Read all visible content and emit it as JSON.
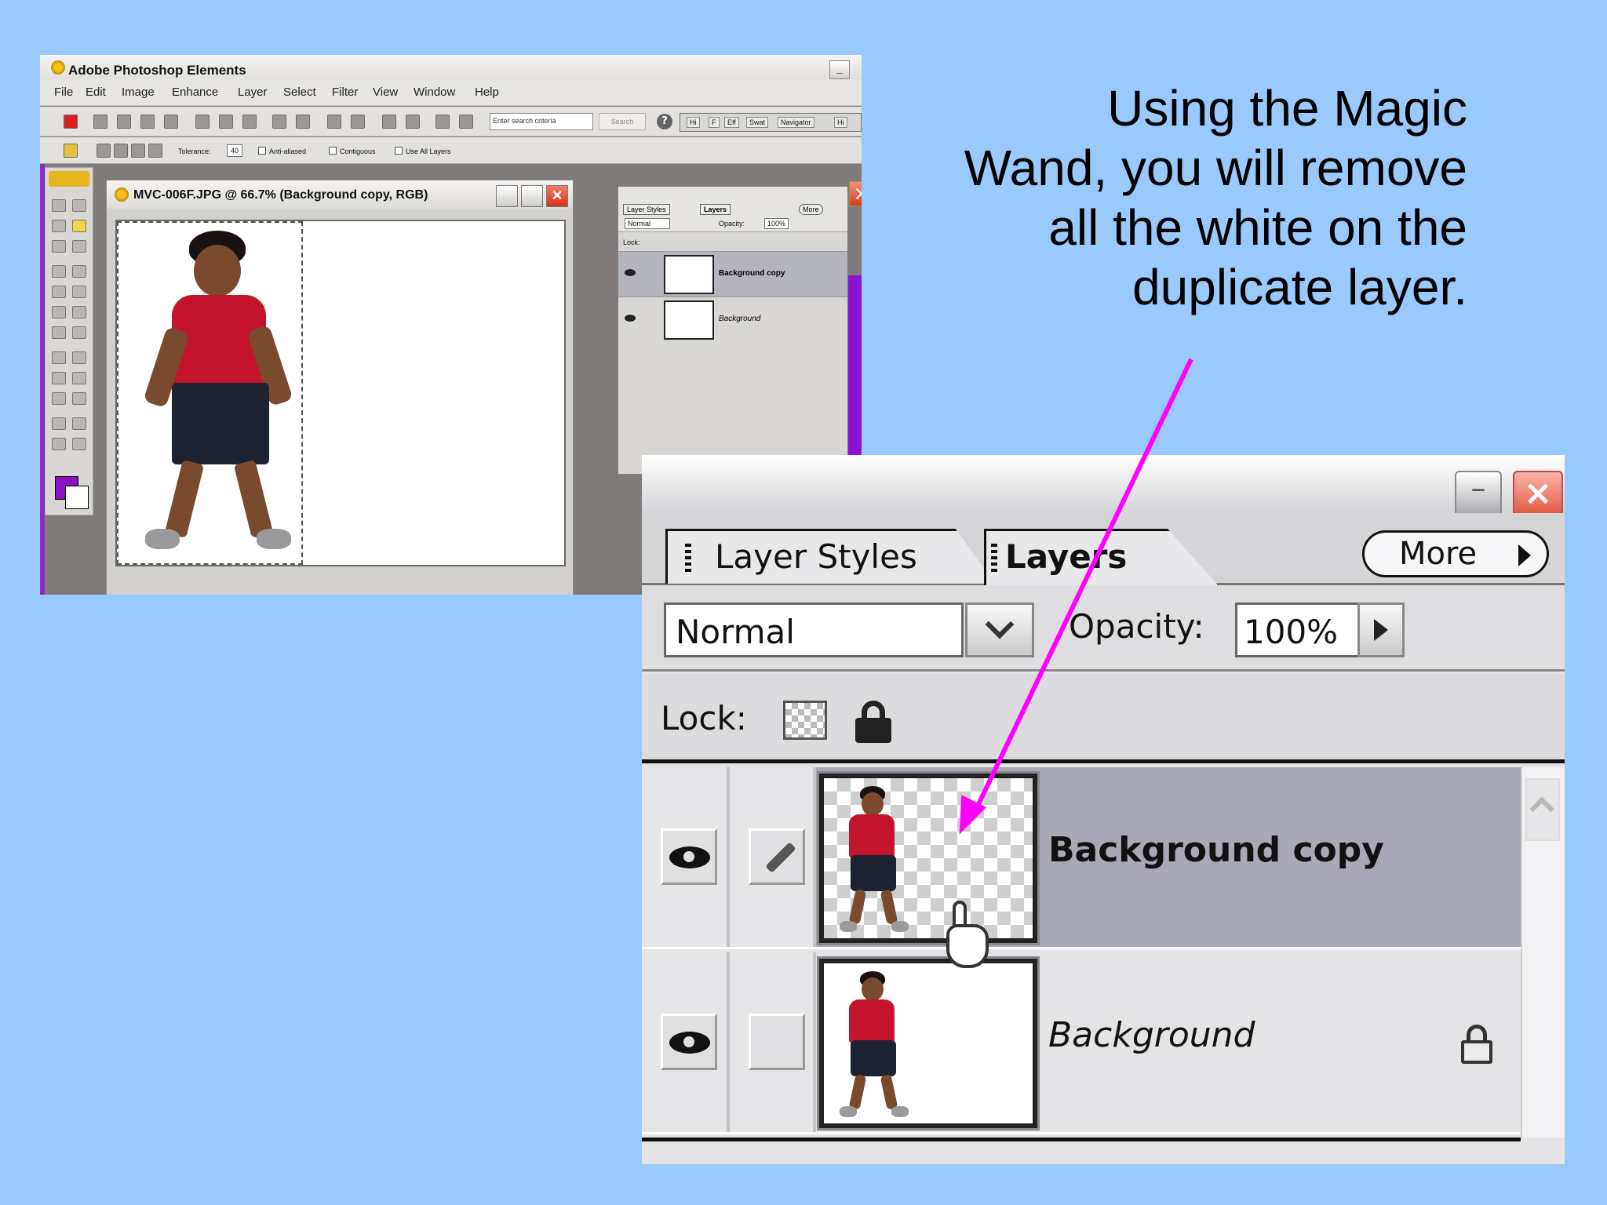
{
  "caption": {
    "lines": [
      "Using the Magic",
      "Wand, you will remove",
      "all the white on the",
      "duplicate layer."
    ]
  },
  "small_screenshot": {
    "app_title": "Adobe Photoshop Elements",
    "menu": [
      "File",
      "Edit",
      "Image",
      "Enhance",
      "Layer",
      "Select",
      "Filter",
      "View",
      "Window",
      "Help"
    ],
    "search_placeholder": "Enter search criteria",
    "search_button": "Search",
    "palette_tabs": [
      "Hi",
      "F",
      "Eff",
      "Swat",
      "Navigator",
      "Hi"
    ],
    "options": {
      "tolerance_label": "Tolerance:",
      "tolerance_value": "40",
      "anti_aliased": "Anti-aliased",
      "contiguous": "Contiguous",
      "use_all_layers": "Use All Layers"
    },
    "doc_title": "MVC-006F.JPG @ 66.7% (Background copy, RGB)",
    "layers_panel": {
      "tabs": [
        "Layer Styles",
        "Layers"
      ],
      "more": "More",
      "blend": "Normal",
      "opacity_label": "Opacity:",
      "opacity_value": "100%",
      "lock_label": "Lock:",
      "layers": [
        "Background copy",
        "Background"
      ]
    },
    "colors": {
      "foreground": "#8710c9",
      "background": "#ffffff",
      "doc_purple": "#8a14d6"
    }
  },
  "layers_panel": {
    "tab_layer_styles": "Layer Styles",
    "tab_layers": "Layers",
    "more_button": "More",
    "blend_mode": "Normal",
    "opacity_label": "Opacity:",
    "opacity_value": "100%",
    "lock_label": "Lock:",
    "layers": [
      {
        "name": "Background copy",
        "selected": true
      },
      {
        "name": "Background",
        "selected": false
      }
    ]
  },
  "colors": {
    "slide_background": "#99c9fd",
    "arrow": "#ff00ff",
    "selected_row": "#a9a9b5"
  },
  "icons": {
    "app": "sunflower-icon",
    "eye": "eye-icon",
    "brush": "brush-link-icon",
    "lock": "lock-icon",
    "transparency_lock": "checkerboard-icon",
    "cursor": "hand-pointer-icon"
  }
}
